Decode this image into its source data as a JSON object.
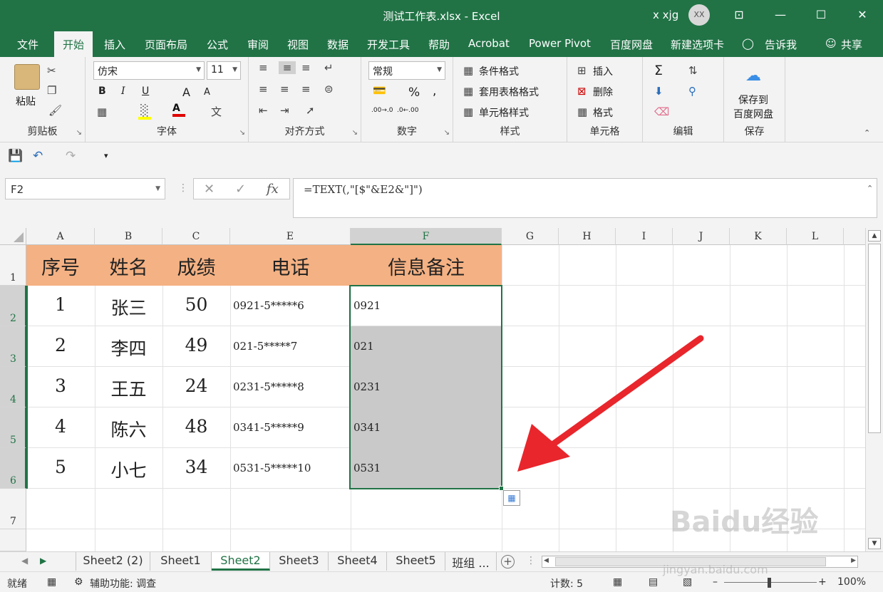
{
  "titlebar": {
    "title": "测试工作表.xlsx  -  Excel",
    "user": "x xjg",
    "avatar": "XX",
    "controls": {
      "ribbon_display": "⊡",
      "minimize": "—",
      "maximize": "☐",
      "close": "✕"
    }
  },
  "menu": {
    "tabs": [
      "文件",
      "开始",
      "插入",
      "页面布局",
      "公式",
      "审阅",
      "视图",
      "数据",
      "开发工具",
      "帮助",
      "Acrobat",
      "Power Pivot",
      "百度网盘",
      "新建选项卡"
    ],
    "active": "开始",
    "tell_me": "告诉我",
    "share": "共享"
  },
  "ribbon": {
    "clipboard": {
      "paste": "粘贴",
      "label": "剪贴板"
    },
    "font": {
      "family": "仿宋",
      "size": "11",
      "bold": "B",
      "italic": "I",
      "underline": "U",
      "grow": "A",
      "shrink": "A",
      "font_color": "A",
      "label": "字体"
    },
    "alignment": {
      "label": "对齐方式"
    },
    "number": {
      "format": "常规",
      "percent": "%",
      "comma": ",",
      "inc": ".00→.0",
      "dec": ".0←.00",
      "label": "数字"
    },
    "styles": {
      "cond": "条件格式",
      "table": "套用表格格式",
      "cell": "单元格样式",
      "label": "样式"
    },
    "cells": {
      "insert": "插入",
      "delete": "删除",
      "format": "格式",
      "label": "单元格"
    },
    "editing": {
      "sum": "Σ",
      "label": "编辑"
    },
    "save": {
      "line1": "保存到",
      "line2": "百度网盘",
      "label": "保存"
    }
  },
  "formula": {
    "namebox": "F2",
    "cancel": "✕",
    "enter": "✓",
    "fx": "fx",
    "content": "=TEXT(,\"[$\"&E2&\"]\")"
  },
  "columns": [
    "A",
    "B",
    "C",
    "E",
    "F",
    "G",
    "H",
    "I",
    "J",
    "K",
    "L"
  ],
  "rows": [
    "1",
    "2",
    "3",
    "4",
    "5",
    "6",
    "7"
  ],
  "table": {
    "headers": [
      "序号",
      "姓名",
      "成绩",
      "电话",
      "信息备注"
    ],
    "rows": [
      [
        "1",
        "张三",
        "50",
        "0921-5*****6",
        "0921"
      ],
      [
        "2",
        "李四",
        "49",
        "021-5*****7",
        "021"
      ],
      [
        "3",
        "王五",
        "24",
        "0231-5*****8",
        "0231"
      ],
      [
        "4",
        "陈六",
        "48",
        "0341-5*****9",
        "0341"
      ],
      [
        "5",
        "小七",
        "34",
        "0531-5*****10",
        "0531"
      ]
    ],
    "header_color": "#f4b183",
    "selection_color": "#217346"
  },
  "sheets": {
    "tabs": [
      "Sheet2 (2)",
      "Sheet1",
      "Sheet2",
      "Sheet3",
      "Sheet4",
      "Sheet5",
      "班组 ..."
    ],
    "active": "Sheet2"
  },
  "status": {
    "ready": "就绪",
    "accessibility": "辅助功能: 调查",
    "count": "计数: 5",
    "zoom": "100%"
  },
  "watermark": {
    "brand": "Baidu经验",
    "url": "jingyan.baidu.com"
  }
}
